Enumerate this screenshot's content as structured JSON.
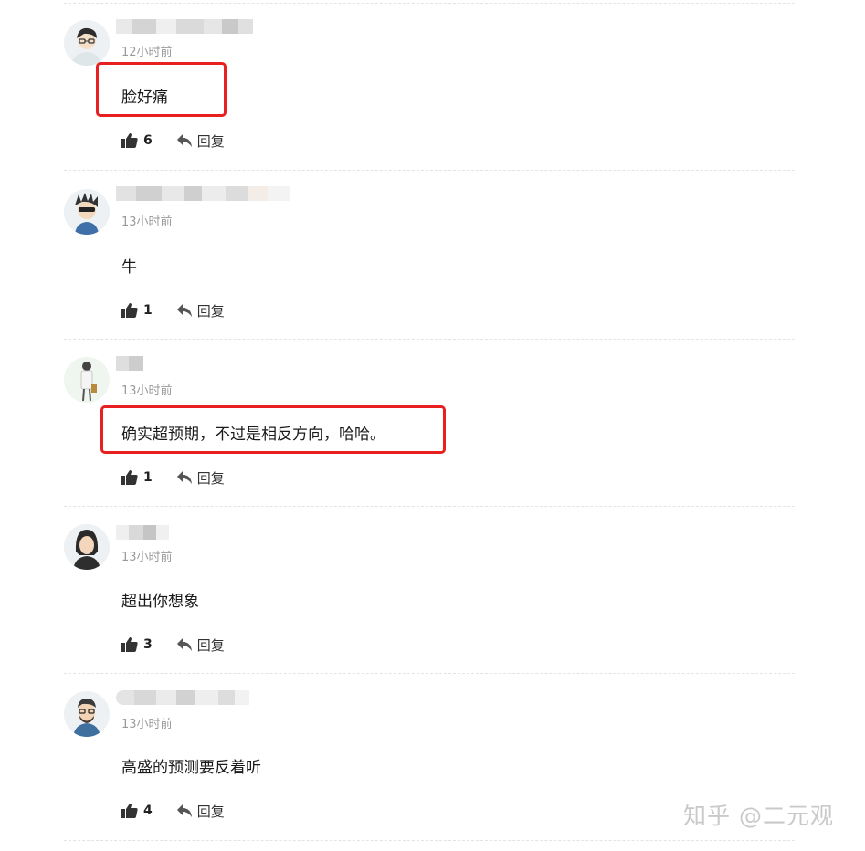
{
  "comments": [
    {
      "time": "12小时前",
      "content": "脸好痛",
      "likes": "6",
      "reply_label": "回复"
    },
    {
      "time": "13小时前",
      "content": "牛",
      "likes": "1",
      "reply_label": "回复"
    },
    {
      "time": "13小时前",
      "content": "确实超预期，不过是相反方向，哈哈。",
      "likes": "1",
      "reply_label": "回复"
    },
    {
      "time": "13小时前",
      "content": "超出你想象",
      "likes": "3",
      "reply_label": "回复"
    },
    {
      "time": "13小时前",
      "content": "高盛的预测要反着听",
      "likes": "4",
      "reply_label": "回复"
    }
  ],
  "watermark": "知乎 @二元观",
  "colors": {
    "highlight": "#e8201f",
    "time": "#9a9a9a",
    "divider": "#e3e3e3"
  },
  "icons": {
    "like": "thumbs-up-icon",
    "reply": "reply-arrow-icon"
  }
}
